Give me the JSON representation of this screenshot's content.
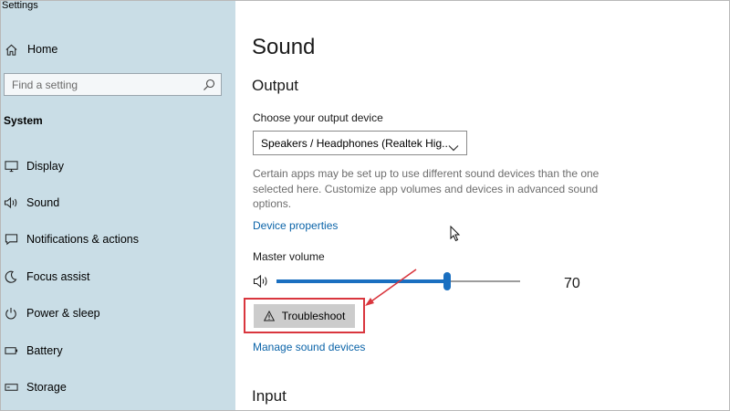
{
  "window": {
    "title": "Settings"
  },
  "sidebar": {
    "home_label": "Home",
    "search_placeholder": "Find a setting",
    "section_label": "System",
    "items": [
      {
        "label": "Display",
        "icon": "monitor-icon"
      },
      {
        "label": "Sound",
        "icon": "speaker-icon"
      },
      {
        "label": "Notifications & actions",
        "icon": "notification-icon"
      },
      {
        "label": "Focus assist",
        "icon": "moon-icon"
      },
      {
        "label": "Power & sleep",
        "icon": "power-icon"
      },
      {
        "label": "Battery",
        "icon": "battery-icon"
      },
      {
        "label": "Storage",
        "icon": "storage-icon"
      }
    ]
  },
  "main": {
    "page_title": "Sound",
    "output": {
      "heading": "Output",
      "device_label": "Choose your output device",
      "device_value": "Speakers / Headphones (Realtek Hig...",
      "description": "Certain apps may be set up to use different sound devices than the one selected here. Customize app volumes and devices in advanced sound options.",
      "device_properties_link": "Device properties",
      "master_volume_label": "Master volume",
      "volume_value": "70",
      "volume_fraction": 0.7,
      "troubleshoot_label": "Troubleshoot",
      "manage_devices_link": "Manage sound devices"
    },
    "input": {
      "heading": "Input"
    }
  },
  "colors": {
    "sidebar_bg": "#c9dde6",
    "accent": "#1a6fc0",
    "link": "#0a63a8",
    "highlight": "#d9363e"
  }
}
